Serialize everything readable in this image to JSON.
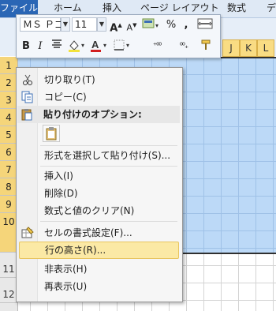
{
  "ribbon": {
    "tabs": [
      "ファイル",
      "ホーム",
      "挿入",
      "ページ レイアウト",
      "数式",
      "デ"
    ]
  },
  "mini_toolbar": {
    "font_name": "ＭＳ Ｐゴ",
    "font_size": "11"
  },
  "grid": {
    "rows": [
      "1",
      "2",
      "3",
      "4",
      "5",
      "6",
      "7",
      "8",
      "9",
      "10",
      "11",
      "12"
    ],
    "columns": [
      "J",
      "K",
      "L"
    ]
  },
  "context_menu": {
    "cut": "切り取り(T)",
    "copy": "コピー(C)",
    "paste_options_header": "貼り付けのオプション:",
    "paste_special": "形式を選択して貼り付け(S)...",
    "insert": "挿入(I)",
    "delete": "削除(D)",
    "clear_contents": "数式と値のクリア(N)",
    "format_cells": "セルの書式設定(F)...",
    "row_height": "行の高さ(R)...",
    "hide": "非表示(H)",
    "unhide": "再表示(U)"
  },
  "colors": {
    "file_tab": "#2a66b5",
    "selection": "#bcd9f7",
    "menu_highlight": "#fbe9a5"
  }
}
